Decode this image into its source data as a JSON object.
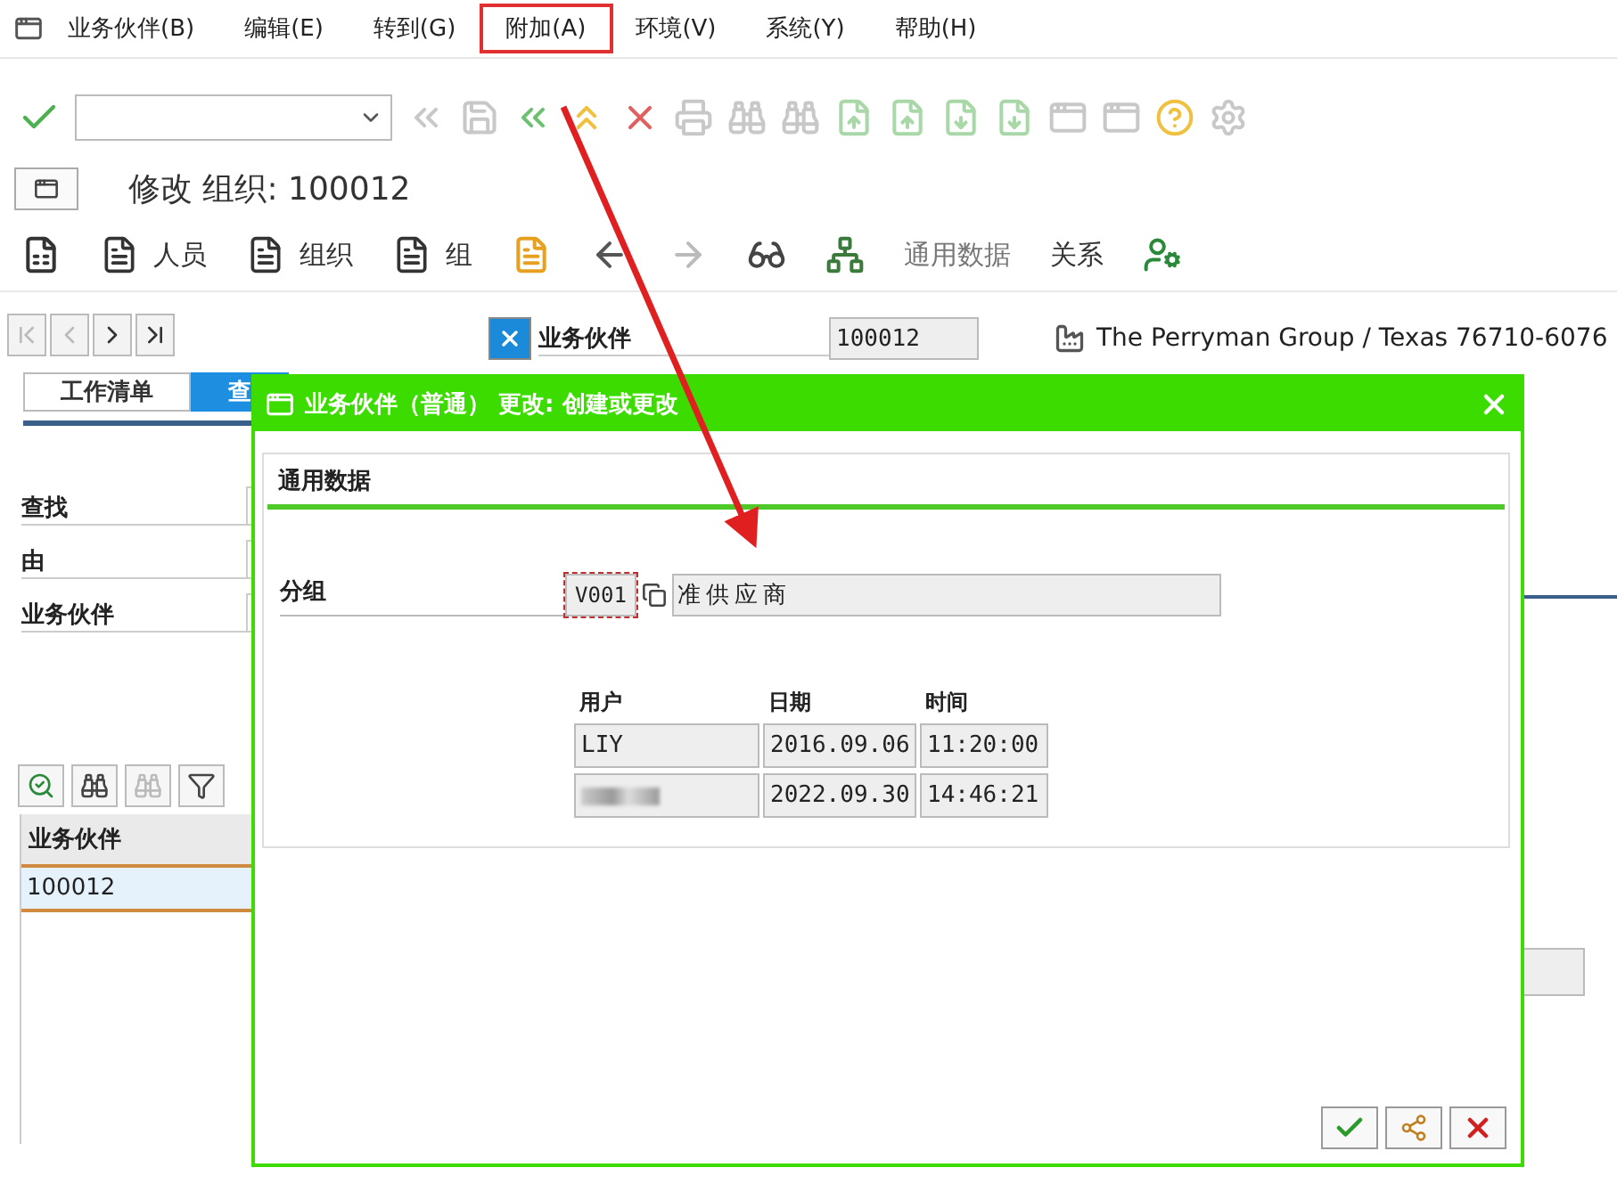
{
  "menu_bar": [
    {
      "label": "业务伙伴(B)",
      "highlighted": false
    },
    {
      "label": "编辑(E)",
      "highlighted": false
    },
    {
      "label": "转到(G)",
      "highlighted": false
    },
    {
      "label": "附加(A)",
      "highlighted": true
    },
    {
      "label": "环境(V)",
      "highlighted": false
    },
    {
      "label": "系统(Y)",
      "highlighted": false
    },
    {
      "label": "帮助(H)",
      "highlighted": false
    }
  ],
  "title": "修改 组织: 100012",
  "app_toolbar": [
    {
      "label": "人员",
      "disabled": false
    },
    {
      "label": "组织",
      "disabled": false
    },
    {
      "label": "组",
      "disabled": false
    },
    {
      "label": "通用数据",
      "disabled": true
    },
    {
      "label": "关系",
      "disabled": false
    }
  ],
  "left_panel": {
    "tabs": [
      {
        "label": "工作清单",
        "selected": false
      },
      {
        "label": "查",
        "selected": true
      }
    ],
    "search_fields": [
      {
        "label": "查找"
      },
      {
        "label": "由"
      },
      {
        "label": "业务伙伴"
      }
    ],
    "results": {
      "column": "业务伙伴",
      "rows": [
        {
          "value": "100012",
          "selected": true
        }
      ]
    }
  },
  "header": {
    "label": "业务伙伴",
    "value": "100012",
    "description": "The Perryman Group / Texas 76710-6076"
  },
  "dialog": {
    "title": "业务伙伴（普通） 更改: 创建或更改",
    "section": "通用数据",
    "grouping": {
      "label": "分组",
      "code": "V001",
      "description": "准供应商"
    },
    "log": {
      "columns": [
        "用户",
        "日期",
        "时间"
      ],
      "rows": [
        {
          "user": "LIY",
          "date": "2016.09.06",
          "time": "11:20:00",
          "redacted": false
        },
        {
          "date": "2022.09.30",
          "time": "14:46:21",
          "redacted": true
        }
      ]
    }
  }
}
